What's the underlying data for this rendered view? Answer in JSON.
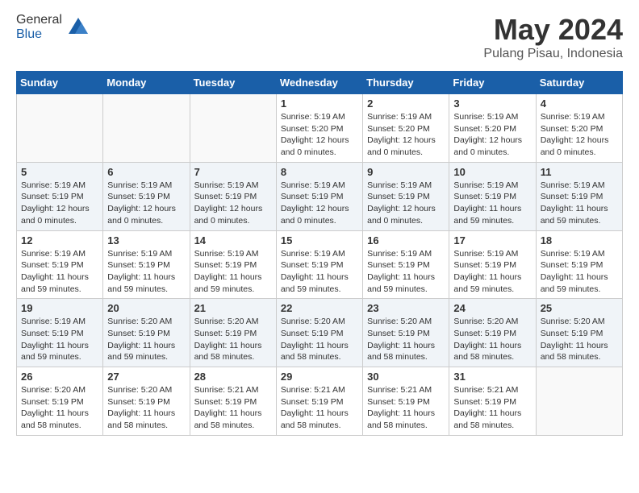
{
  "header": {
    "logo_line1": "General",
    "logo_line2": "Blue",
    "month": "May 2024",
    "location": "Pulang Pisau, Indonesia"
  },
  "weekdays": [
    "Sunday",
    "Monday",
    "Tuesday",
    "Wednesday",
    "Thursday",
    "Friday",
    "Saturday"
  ],
  "weeks": [
    [
      {
        "day": "",
        "info": ""
      },
      {
        "day": "",
        "info": ""
      },
      {
        "day": "",
        "info": ""
      },
      {
        "day": "1",
        "info": "Sunrise: 5:19 AM\nSunset: 5:20 PM\nDaylight: 12 hours and 0 minutes."
      },
      {
        "day": "2",
        "info": "Sunrise: 5:19 AM\nSunset: 5:20 PM\nDaylight: 12 hours and 0 minutes."
      },
      {
        "day": "3",
        "info": "Sunrise: 5:19 AM\nSunset: 5:20 PM\nDaylight: 12 hours and 0 minutes."
      },
      {
        "day": "4",
        "info": "Sunrise: 5:19 AM\nSunset: 5:20 PM\nDaylight: 12 hours and 0 minutes."
      }
    ],
    [
      {
        "day": "5",
        "info": "Sunrise: 5:19 AM\nSunset: 5:19 PM\nDaylight: 12 hours and 0 minutes."
      },
      {
        "day": "6",
        "info": "Sunrise: 5:19 AM\nSunset: 5:19 PM\nDaylight: 12 hours and 0 minutes."
      },
      {
        "day": "7",
        "info": "Sunrise: 5:19 AM\nSunset: 5:19 PM\nDaylight: 12 hours and 0 minutes."
      },
      {
        "day": "8",
        "info": "Sunrise: 5:19 AM\nSunset: 5:19 PM\nDaylight: 12 hours and 0 minutes."
      },
      {
        "day": "9",
        "info": "Sunrise: 5:19 AM\nSunset: 5:19 PM\nDaylight: 12 hours and 0 minutes."
      },
      {
        "day": "10",
        "info": "Sunrise: 5:19 AM\nSunset: 5:19 PM\nDaylight: 11 hours and 59 minutes."
      },
      {
        "day": "11",
        "info": "Sunrise: 5:19 AM\nSunset: 5:19 PM\nDaylight: 11 hours and 59 minutes."
      }
    ],
    [
      {
        "day": "12",
        "info": "Sunrise: 5:19 AM\nSunset: 5:19 PM\nDaylight: 11 hours and 59 minutes."
      },
      {
        "day": "13",
        "info": "Sunrise: 5:19 AM\nSunset: 5:19 PM\nDaylight: 11 hours and 59 minutes."
      },
      {
        "day": "14",
        "info": "Sunrise: 5:19 AM\nSunset: 5:19 PM\nDaylight: 11 hours and 59 minutes."
      },
      {
        "day": "15",
        "info": "Sunrise: 5:19 AM\nSunset: 5:19 PM\nDaylight: 11 hours and 59 minutes."
      },
      {
        "day": "16",
        "info": "Sunrise: 5:19 AM\nSunset: 5:19 PM\nDaylight: 11 hours and 59 minutes."
      },
      {
        "day": "17",
        "info": "Sunrise: 5:19 AM\nSunset: 5:19 PM\nDaylight: 11 hours and 59 minutes."
      },
      {
        "day": "18",
        "info": "Sunrise: 5:19 AM\nSunset: 5:19 PM\nDaylight: 11 hours and 59 minutes."
      }
    ],
    [
      {
        "day": "19",
        "info": "Sunrise: 5:19 AM\nSunset: 5:19 PM\nDaylight: 11 hours and 59 minutes."
      },
      {
        "day": "20",
        "info": "Sunrise: 5:20 AM\nSunset: 5:19 PM\nDaylight: 11 hours and 59 minutes."
      },
      {
        "day": "21",
        "info": "Sunrise: 5:20 AM\nSunset: 5:19 PM\nDaylight: 11 hours and 58 minutes."
      },
      {
        "day": "22",
        "info": "Sunrise: 5:20 AM\nSunset: 5:19 PM\nDaylight: 11 hours and 58 minutes."
      },
      {
        "day": "23",
        "info": "Sunrise: 5:20 AM\nSunset: 5:19 PM\nDaylight: 11 hours and 58 minutes."
      },
      {
        "day": "24",
        "info": "Sunrise: 5:20 AM\nSunset: 5:19 PM\nDaylight: 11 hours and 58 minutes."
      },
      {
        "day": "25",
        "info": "Sunrise: 5:20 AM\nSunset: 5:19 PM\nDaylight: 11 hours and 58 minutes."
      }
    ],
    [
      {
        "day": "26",
        "info": "Sunrise: 5:20 AM\nSunset: 5:19 PM\nDaylight: 11 hours and 58 minutes."
      },
      {
        "day": "27",
        "info": "Sunrise: 5:20 AM\nSunset: 5:19 PM\nDaylight: 11 hours and 58 minutes."
      },
      {
        "day": "28",
        "info": "Sunrise: 5:21 AM\nSunset: 5:19 PM\nDaylight: 11 hours and 58 minutes."
      },
      {
        "day": "29",
        "info": "Sunrise: 5:21 AM\nSunset: 5:19 PM\nDaylight: 11 hours and 58 minutes."
      },
      {
        "day": "30",
        "info": "Sunrise: 5:21 AM\nSunset: 5:19 PM\nDaylight: 11 hours and 58 minutes."
      },
      {
        "day": "31",
        "info": "Sunrise: 5:21 AM\nSunset: 5:19 PM\nDaylight: 11 hours and 58 minutes."
      },
      {
        "day": "",
        "info": ""
      }
    ]
  ]
}
